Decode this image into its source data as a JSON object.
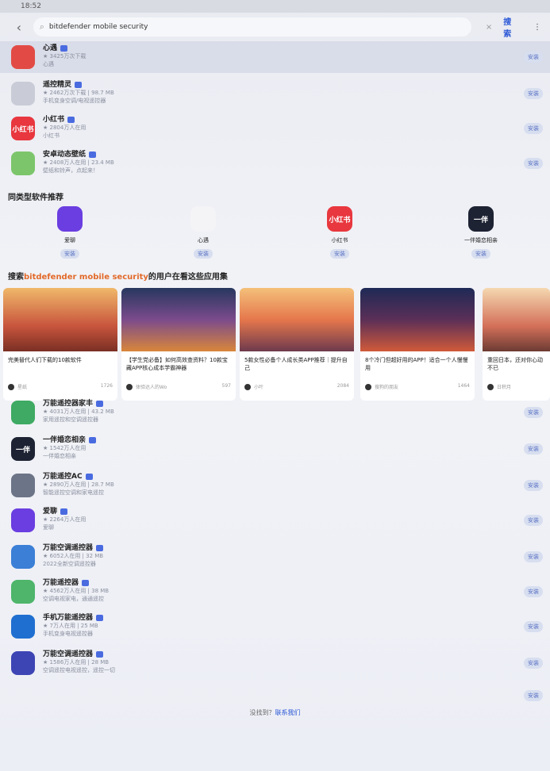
{
  "status": {
    "time": "18:52"
  },
  "search": {
    "query": "bitdefender mobile security",
    "clear": "×",
    "button": "搜索",
    "more": "⋮"
  },
  "top_results": [
    {
      "name": "心遇",
      "meta": "★ 3425万次下载",
      "desc": "心遇",
      "icon_color": "#e24b45",
      "icon_text": "",
      "install": "安装",
      "highlight": true
    },
    {
      "name": "遥控精灵",
      "meta": "★ 2462万次下载 | 98.7 MB",
      "desc": "手机变身空调/电视遥控器",
      "icon_color": "#c9ccd6",
      "icon_text": "",
      "install": "安装",
      "highlight": false
    },
    {
      "name": "小红书",
      "meta": "★ 2804万人在用",
      "desc": "小红书",
      "icon_color": "#e8373e",
      "icon_text": "小红书",
      "install": "安装",
      "highlight": false
    },
    {
      "name": "安卓动态壁纸",
      "meta": "★ 2408万人在用 | 23.4 MB",
      "desc": "壁纸和铃声，点起来！",
      "icon_color": "#7cc56b",
      "icon_text": "",
      "install": "安装",
      "highlight": false
    }
  ],
  "similar": {
    "title": "同类型软件推荐",
    "items": [
      {
        "name": "爱聊",
        "icon_color": "#6a3ee0",
        "icon_text": "",
        "install": "安装"
      },
      {
        "name": "心遇",
        "icon_color": "#f4f4f7",
        "icon_text": "",
        "install": "安装"
      },
      {
        "name": "小红书",
        "icon_color": "#e8373e",
        "icon_text": "小红书",
        "install": "安装"
      },
      {
        "name": "一伴婚恋相亲",
        "icon_color": "#1d2333",
        "icon_text": "一伴",
        "install": "安装"
      }
    ]
  },
  "collections": {
    "title_pre": "搜索",
    "title_hl": "bitdefender mobile security",
    "title_post": "的用户在看这些应用集",
    "cards": [
      {
        "title": "完美替代人们下载的10款软件",
        "author": "星纸",
        "count": "1726",
        "bg": "linear-gradient(180deg,#f0b86a 0%,#c8553d 60%,#7a2f24 100%)"
      },
      {
        "title": "【学生党必备】如何高效查资料？10款宝藏APP核心成本学霸神器",
        "author": "体验达人的Wo",
        "count": "597",
        "bg": "linear-gradient(180deg,#27375e 0%,#7b4b8c 50%,#d9863a 100%)"
      },
      {
        "title": "5款女性必备个人成长类APP推荐｜提升自己",
        "author": "小叶",
        "count": "2084",
        "bg": "linear-gradient(180deg,#f4c07a 0%,#e5774c 50%,#6d3a4d 100%)"
      },
      {
        "title": "8个冷门但超好用的APP！适合一个人慢慢用",
        "author": "搜狗的朋友",
        "count": "1464",
        "bg": "linear-gradient(180deg,#1e2a56 0%,#5b2f57 50%,#d05a3a 100%)"
      },
      {
        "title": "重回日本，还对你心动不已",
        "author": "日积月",
        "count": "",
        "bg": "linear-gradient(180deg,#f4d8b0 0%,#d4705a 60%,#6c3b33 100%)"
      }
    ]
  },
  "more_results": [
    {
      "name": "万能遥控器家丰",
      "meta": "★ 4031万人在用 | 43.2 MB",
      "desc": "家用遥控和空调遥控器",
      "icon_color": "#3eaa63",
      "icon_text": "",
      "install": "安装"
    },
    {
      "name": "一伴婚恋相亲",
      "meta": "★ 1542万人在用",
      "desc": "一伴婚恋相亲",
      "icon_color": "#1d2333",
      "icon_text": "一伴",
      "install": "安装"
    },
    {
      "name": "万能遥控AC",
      "meta": "★ 2890万人在用 | 28.7 MB",
      "desc": "智能遥控空调和家电遥控",
      "icon_color": "#6c7487",
      "icon_text": "",
      "install": "安装"
    },
    {
      "name": "爱聊",
      "meta": "★ 2264万人在用",
      "desc": "爱聊",
      "icon_color": "#6a3ee0",
      "icon_text": "",
      "install": "安装"
    },
    {
      "name": "万能空调遥控器",
      "meta": "★ 6052人在用 | 32 MB",
      "desc": "2022全新空调遥控器",
      "icon_color": "#3b7fd6",
      "icon_text": "",
      "install": "安装"
    },
    {
      "name": "万能遥控器",
      "meta": "★ 4562万人在用 | 38 MB",
      "desc": "空调电视家电，通通遥控",
      "icon_color": "#4eb56a",
      "icon_text": "",
      "install": "安装"
    },
    {
      "name": "手机万能遥控器",
      "meta": "★ 7万人在用 | 25 MB",
      "desc": "手机变身电视遥控器",
      "icon_color": "#1f6fd0",
      "icon_text": "",
      "install": "安装"
    },
    {
      "name": "万能空调遥控器",
      "meta": "★ 1586万人在用 | 28 MB",
      "desc": "空调遥控电视遥控，遥控一切",
      "icon_color": "#3d45b5",
      "icon_text": "",
      "install": "安装"
    }
  ],
  "extra_install": "安装",
  "footer": {
    "pre": "没找到？",
    "link": "联系我们"
  }
}
